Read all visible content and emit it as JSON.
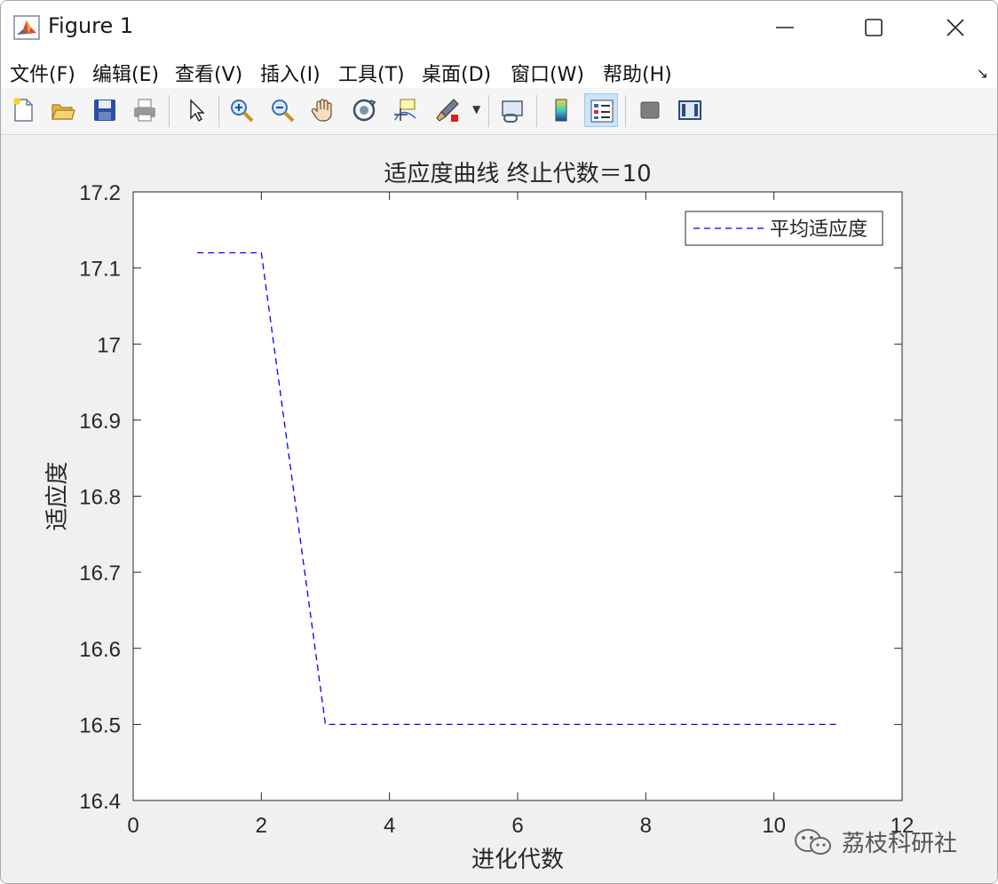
{
  "window": {
    "title": "Figure 1"
  },
  "menu": {
    "items": [
      "文件(F)",
      "编辑(E)",
      "查看(V)",
      "插入(I)",
      "工具(T)",
      "桌面(D)",
      "窗口(W)",
      "帮助(H)"
    ]
  },
  "toolbar": {
    "buttons": [
      {
        "icon": "new-figure-icon"
      },
      {
        "icon": "open-file-icon"
      },
      {
        "icon": "save-icon"
      },
      {
        "icon": "print-icon"
      },
      {
        "icon": "pointer-icon"
      },
      {
        "icon": "zoom-in-icon"
      },
      {
        "icon": "zoom-out-icon"
      },
      {
        "icon": "pan-icon"
      },
      {
        "icon": "rotate-3d-icon"
      },
      {
        "icon": "data-cursor-icon"
      },
      {
        "icon": "brush-icon"
      },
      {
        "icon": "link-plot-icon"
      },
      {
        "icon": "colorbar-icon"
      },
      {
        "icon": "legend-icon",
        "active": true
      },
      {
        "icon": "hide-plot-tools-icon"
      },
      {
        "icon": "show-plot-tools-icon"
      }
    ]
  },
  "watermark": {
    "text": "荔枝科研社"
  },
  "chart_data": {
    "type": "line",
    "title": "适应度曲线 终止代数＝10",
    "xlabel": "进化代数",
    "ylabel": "适应度",
    "xlim": [
      0,
      12
    ],
    "ylim": [
      16.4,
      17.2
    ],
    "xticks": [
      0,
      2,
      4,
      6,
      8,
      10,
      12
    ],
    "yticks": [
      16.4,
      16.5,
      16.6,
      16.7,
      16.8,
      16.9,
      17,
      17.1,
      17.2
    ],
    "grid": false,
    "legend_position": "top-right",
    "series": [
      {
        "name": "平均适应度",
        "color": "#0000ff",
        "line_style": "dashed",
        "x": [
          1,
          2,
          3,
          4,
          5,
          6,
          7,
          8,
          9,
          10,
          11
        ],
        "y": [
          17.12,
          17.12,
          16.5,
          16.5,
          16.5,
          16.5,
          16.5,
          16.5,
          16.5,
          16.5,
          16.5
        ]
      }
    ]
  }
}
